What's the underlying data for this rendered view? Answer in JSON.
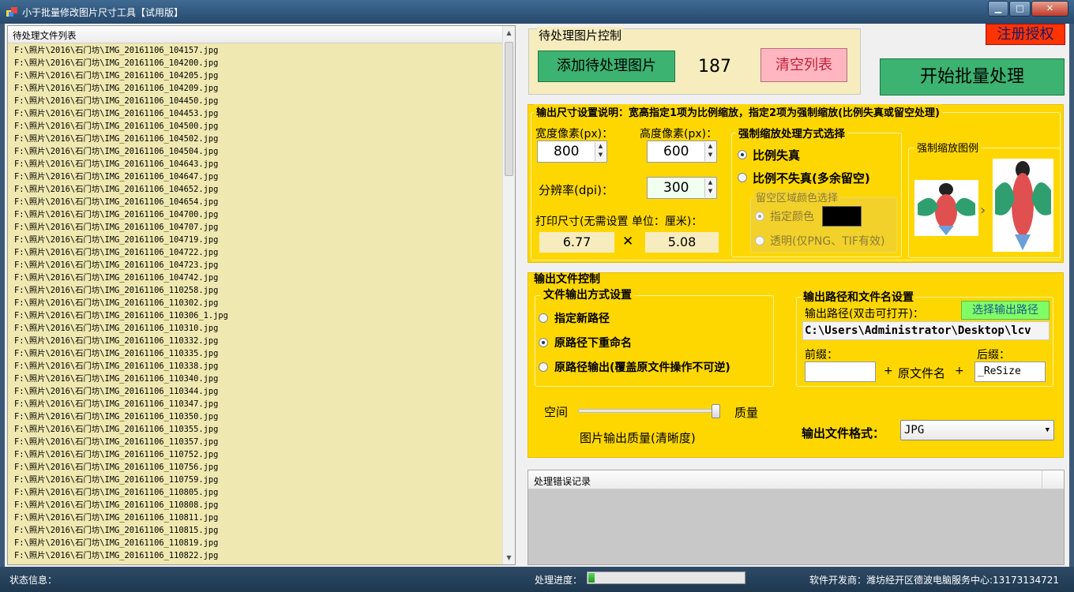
{
  "window": {
    "title": "小于批量修改图片尺寸工具【试用版】",
    "min_glyph": "▁",
    "max_glyph": "□",
    "close_glyph": "✕"
  },
  "filelist": {
    "header": "待处理文件列表",
    "items": [
      "F:\\照片\\2016\\石门坊\\IMG_20161106_104157.jpg",
      "F:\\照片\\2016\\石门坊\\IMG_20161106_104200.jpg",
      "F:\\照片\\2016\\石门坊\\IMG_20161106_104205.jpg",
      "F:\\照片\\2016\\石门坊\\IMG_20161106_104209.jpg",
      "F:\\照片\\2016\\石门坊\\IMG_20161106_104450.jpg",
      "F:\\照片\\2016\\石门坊\\IMG_20161106_104453.jpg",
      "F:\\照片\\2016\\石门坊\\IMG_20161106_104500.jpg",
      "F:\\照片\\2016\\石门坊\\IMG_20161106_104502.jpg",
      "F:\\照片\\2016\\石门坊\\IMG_20161106_104504.jpg",
      "F:\\照片\\2016\\石门坊\\IMG_20161106_104643.jpg",
      "F:\\照片\\2016\\石门坊\\IMG_20161106_104647.jpg",
      "F:\\照片\\2016\\石门坊\\IMG_20161106_104652.jpg",
      "F:\\照片\\2016\\石门坊\\IMG_20161106_104654.jpg",
      "F:\\照片\\2016\\石门坊\\IMG_20161106_104700.jpg",
      "F:\\照片\\2016\\石门坊\\IMG_20161106_104707.jpg",
      "F:\\照片\\2016\\石门坊\\IMG_20161106_104719.jpg",
      "F:\\照片\\2016\\石门坊\\IMG_20161106_104722.jpg",
      "F:\\照片\\2016\\石门坊\\IMG_20161106_104723.jpg",
      "F:\\照片\\2016\\石门坊\\IMG_20161106_104742.jpg",
      "F:\\照片\\2016\\石门坊\\IMG_20161106_110258.jpg",
      "F:\\照片\\2016\\石门坊\\IMG_20161106_110302.jpg",
      "F:\\照片\\2016\\石门坊\\IMG_20161106_110306_1.jpg",
      "F:\\照片\\2016\\石门坊\\IMG_20161106_110310.jpg",
      "F:\\照片\\2016\\石门坊\\IMG_20161106_110332.jpg",
      "F:\\照片\\2016\\石门坊\\IMG_20161106_110335.jpg",
      "F:\\照片\\2016\\石门坊\\IMG_20161106_110338.jpg",
      "F:\\照片\\2016\\石门坊\\IMG_20161106_110340.jpg",
      "F:\\照片\\2016\\石门坊\\IMG_20161106_110344.jpg",
      "F:\\照片\\2016\\石门坊\\IMG_20161106_110347.jpg",
      "F:\\照片\\2016\\石门坊\\IMG_20161106_110350.jpg",
      "F:\\照片\\2016\\石门坊\\IMG_20161106_110355.jpg",
      "F:\\照片\\2016\\石门坊\\IMG_20161106_110357.jpg",
      "F:\\照片\\2016\\石门坊\\IMG_20161106_110752.jpg",
      "F:\\照片\\2016\\石门坊\\IMG_20161106_110756.jpg",
      "F:\\照片\\2016\\石门坊\\IMG_20161106_110759.jpg",
      "F:\\照片\\2016\\石门坊\\IMG_20161106_110805.jpg",
      "F:\\照片\\2016\\石门坊\\IMG_20161106_110808.jpg",
      "F:\\照片\\2016\\石门坊\\IMG_20161106_110811.jpg",
      "F:\\照片\\2016\\石门坊\\IMG_20161106_110815.jpg",
      "F:\\照片\\2016\\石门坊\\IMG_20161106_110819.jpg",
      "F:\\照片\\2016\\石门坊\\IMG_20161106_110822.jpg"
    ]
  },
  "image_control": {
    "group_title": "待处理图片控制",
    "add_button": "添加待处理图片",
    "count": "187",
    "clear_button": "清空列表",
    "register_button": "注册授权",
    "start_button": "开始批量处理"
  },
  "size_settings": {
    "title": "输出尺寸设置说明：宽高指定1项为比例缩放，指定2项为强制缩放(比例失真或留空处理)",
    "width_label": "宽度像素(px)：",
    "width_value": "800",
    "height_label": "高度像素(px)：",
    "height_value": "600",
    "dpi_label": "分辨率(dpi)：",
    "dpi_value": "300",
    "print_label": "打印尺寸(无需设置 单位：厘米)：",
    "print_width": "6.77",
    "times_sign": "✕",
    "print_height": "5.08",
    "force_group_title": "强制缩放处理方式选择",
    "opt_distort": "比例失真",
    "opt_keep": "比例不失真(多余留空)",
    "blank_group_title": "留空区域颜色选择",
    "opt_color": "指定颜色",
    "fill_color": "#000000",
    "opt_transparent": "透明(仅PNG、TIF有效)",
    "example_title": "强制缩放图例",
    "arrow": "›"
  },
  "output": {
    "title": "输出文件控制",
    "mode_group_title": "文件输出方式设置",
    "opt_new_path": "指定新路径",
    "opt_rename": "原路径下重命名",
    "opt_overwrite": "原路径输出(覆盖原文件操作不可逆)",
    "path_group_title": "输出路径和文件名设置",
    "path_label": "输出路径(双击可打开)：",
    "choose_path_button": "选择输出路径",
    "path_value": "C:\\Users\\Administrator\\Desktop\\lcv",
    "prefix_label": "前缀：",
    "prefix_value": "",
    "plus1": "+",
    "original_name": "原文件名",
    "plus2": "+",
    "suffix_label": "后缀：",
    "suffix_value": "_ReSize",
    "space_label": "空间",
    "quality_label": "质量",
    "quality_caption": "图片输出质量(清晰度)",
    "quality_level": 0.98,
    "format_label": "输出文件格式：",
    "format_value": "JPG"
  },
  "errors": {
    "header": "处理错误记录"
  },
  "status": {
    "info_label": "状态信息：",
    "progress_label": "处理进度：",
    "progress": 0.04,
    "developer": "软件开发商：潍坊经开区德波电脑服务中心:13173134721"
  },
  "colors": {
    "accent_yellow": "#ffd700",
    "green_button": "#3cb371",
    "register_red": "#ff3300"
  }
}
